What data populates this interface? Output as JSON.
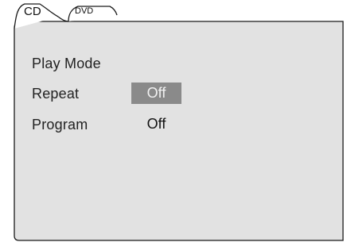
{
  "tabs": [
    {
      "label": "CD"
    },
    {
      "label": "DVD"
    }
  ],
  "menu": {
    "items": [
      {
        "label": "Play Mode",
        "value": ""
      },
      {
        "label": "Repeat",
        "value": "Off"
      },
      {
        "label": "Program",
        "value": "Off"
      }
    ]
  },
  "colors": {
    "panel_background": "#e2e2e2",
    "highlight": "#8a8a8a",
    "outline": "#1a1a1a"
  }
}
